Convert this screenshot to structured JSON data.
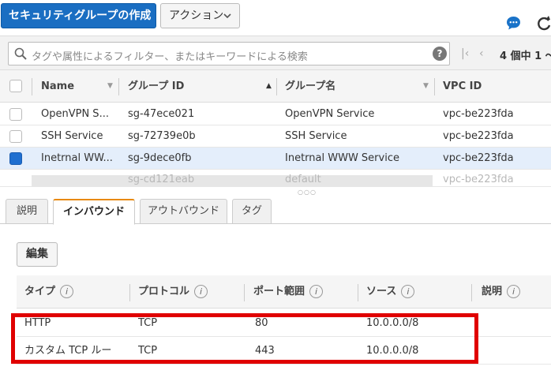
{
  "toolbar": {
    "create_label": "セキュリティグループの作成",
    "action_label": "アクション"
  },
  "search": {
    "placeholder": "タグや属性によるフィルター、またはキーワードによる検索",
    "help": "?"
  },
  "pager": {
    "first": "|‹",
    "prev": "‹",
    "text": "4 個中 1 〜"
  },
  "table": {
    "columns": [
      "Name",
      "グループ ID",
      "グループ名",
      "VPC ID"
    ],
    "rows": [
      {
        "name": "OpenVPN S...",
        "group_id": "sg-47ece021",
        "group_name": "OpenVPN Service",
        "vpc_id": "vpc-be223fda",
        "checked": false
      },
      {
        "name": "SSH Service",
        "group_id": "sg-72739e0b",
        "group_name": "SSH Service",
        "vpc_id": "vpc-be223fda",
        "checked": false
      },
      {
        "name": "Inetrnal WW...",
        "group_id": "sg-9dece0fb",
        "group_name": "Inetrnal WWW Service",
        "vpc_id": "vpc-be223fda",
        "checked": true
      },
      {
        "name": "",
        "group_id": "sg-cd121eab",
        "group_name": "default",
        "vpc_id": "vpc-be223fda",
        "checked": false
      }
    ]
  },
  "tabs": [
    {
      "label": "説明",
      "active": false
    },
    {
      "label": "インバウンド",
      "active": true
    },
    {
      "label": "アウトバウンド",
      "active": false
    },
    {
      "label": "タグ",
      "active": false
    }
  ],
  "detail": {
    "edit_label": "編集",
    "columns": [
      "タイプ",
      "プロトコル",
      "ポート範囲",
      "ソース",
      "説明"
    ],
    "info_glyph": "i",
    "rules": [
      {
        "type": "HTTP",
        "protocol": "TCP",
        "port": "80",
        "source": "10.0.0.0/8",
        "description": ""
      },
      {
        "type": "カスタム TCP ルー",
        "protocol": "TCP",
        "port": "443",
        "source": "10.0.0.0/8",
        "description": ""
      }
    ]
  },
  "colors": {
    "primary": "#1a6ec2",
    "highlight": "#e00000",
    "active_tab": "#e8890c",
    "selected_row": "#e4eefb"
  }
}
